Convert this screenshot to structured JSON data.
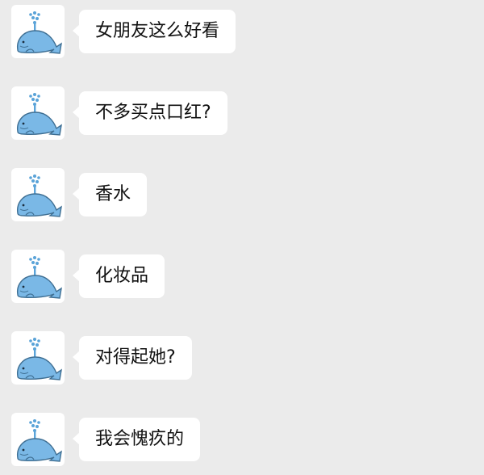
{
  "colors": {
    "background": "#ebebeb",
    "bubble": "#ffffff",
    "whale": "#7ab8e6",
    "spout": "#5aa3d8"
  },
  "avatar_icon": "blue-whale-icon",
  "messages": [
    {
      "text": "女朋友这么好看"
    },
    {
      "text": "不多买点口红?"
    },
    {
      "text": "香水"
    },
    {
      "text": "化妆品"
    },
    {
      "text": "对得起她?"
    },
    {
      "text": "我会愧疚的"
    }
  ]
}
